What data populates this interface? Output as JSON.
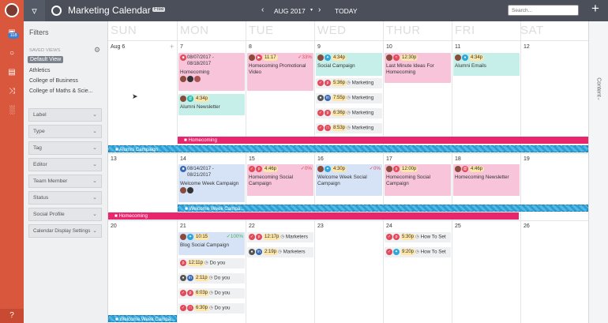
{
  "header": {
    "app_title": "Marketing Calendar",
    "plan_badge": "Free",
    "month": "AUG 2017",
    "today": "TODAY",
    "search_placeholder": "Search...",
    "add": "+"
  },
  "rail": {
    "badge_count": "118",
    "help": "?"
  },
  "sidebar": {
    "title": "Filters",
    "saved_views_heading": "SAVED VIEWS",
    "views": [
      "Default View",
      "Athletics",
      "College of Business",
      "College of Maths & Scie..."
    ],
    "filters": [
      "Label",
      "Type",
      "Tag",
      "Editor",
      "Team Member",
      "Status",
      "Social Profile",
      "Calendar Display Settings"
    ]
  },
  "right_panel": {
    "label": "Content"
  },
  "days": [
    "SUN",
    "MON",
    "TUE",
    "WED",
    "THUR",
    "FRI",
    "SAT"
  ],
  "weeks": {
    "w1": {
      "nums": [
        "Aug 6",
        "7",
        "8",
        "9",
        "10",
        "11",
        "12"
      ]
    },
    "w2": {
      "nums": [
        "13",
        "14",
        "15",
        "16",
        "17",
        "18",
        "19"
      ]
    },
    "w3": {
      "nums": [
        "20",
        "21",
        "22",
        "23",
        "24",
        "25",
        "26"
      ]
    }
  },
  "cards": {
    "c1": {
      "dates": "08/07/2017 -\n08/18/2017",
      "title": "Homecoming"
    },
    "c2": {
      "time": "4:34p",
      "title": "Alumni Newsletter"
    },
    "c3": {
      "time": "11:17",
      "pct": "33%",
      "title": "Homecoming Promotional Video"
    },
    "c4": {
      "time": "4:34p",
      "title": "Social Campaign"
    },
    "c5": {
      "time": "5:36p",
      "label": "Marketing"
    },
    "c6": {
      "time": "7:55p",
      "label": "Marketing"
    },
    "c7": {
      "time": "6:36p",
      "label": "Marketing"
    },
    "c8": {
      "time": "8:53p",
      "label": "Marketing"
    },
    "c9": {
      "time": "12:30p",
      "title": "Last Minute Ideas For Homecoming"
    },
    "c10": {
      "time": "4:34p",
      "title": "Alumni Emails"
    },
    "c11": {
      "dates": "08/14/2017 -\n08/21/2017",
      "title": "Welcome Week Campaign"
    },
    "c12": {
      "time": "4:46p",
      "pct": "0%",
      "title": "Homecoming Social Campaign"
    },
    "c13": {
      "time": "4:30p",
      "pct": "0%",
      "title": "Welcome Week Social Campaign"
    },
    "c14": {
      "time": "12:00p",
      "title": "Homecoming Social Campaign"
    },
    "c15": {
      "time": "4:46p",
      "title": "Homecoming Newsletter"
    },
    "c16": {
      "time": "10:15",
      "pct": "100%",
      "title": "Blog Social Campaign"
    },
    "c17": {
      "time": "12:11p",
      "label": "Do you"
    },
    "c18": {
      "time": "2:11p",
      "label": "Do you"
    },
    "c19": {
      "time": "6:03p",
      "label": "Do you"
    },
    "c20": {
      "time": "6:30p",
      "label": "Do you"
    },
    "c21": {
      "time": "12:17p",
      "label": "Marketers"
    },
    "c22": {
      "time": "2:19p",
      "label": "Marketers"
    },
    "c23": {
      "time": "5:30p",
      "label": "How To Set"
    },
    "c24": {
      "time": "9:20p",
      "label": "How To Set"
    }
  },
  "bars": {
    "homecoming": "Homecoming",
    "alumni": "Alumni Campaign",
    "welcome": "Welcome Week Campa...",
    "homecoming2": "Homecoming",
    "welcome2": "Welcome Week Campa..."
  }
}
